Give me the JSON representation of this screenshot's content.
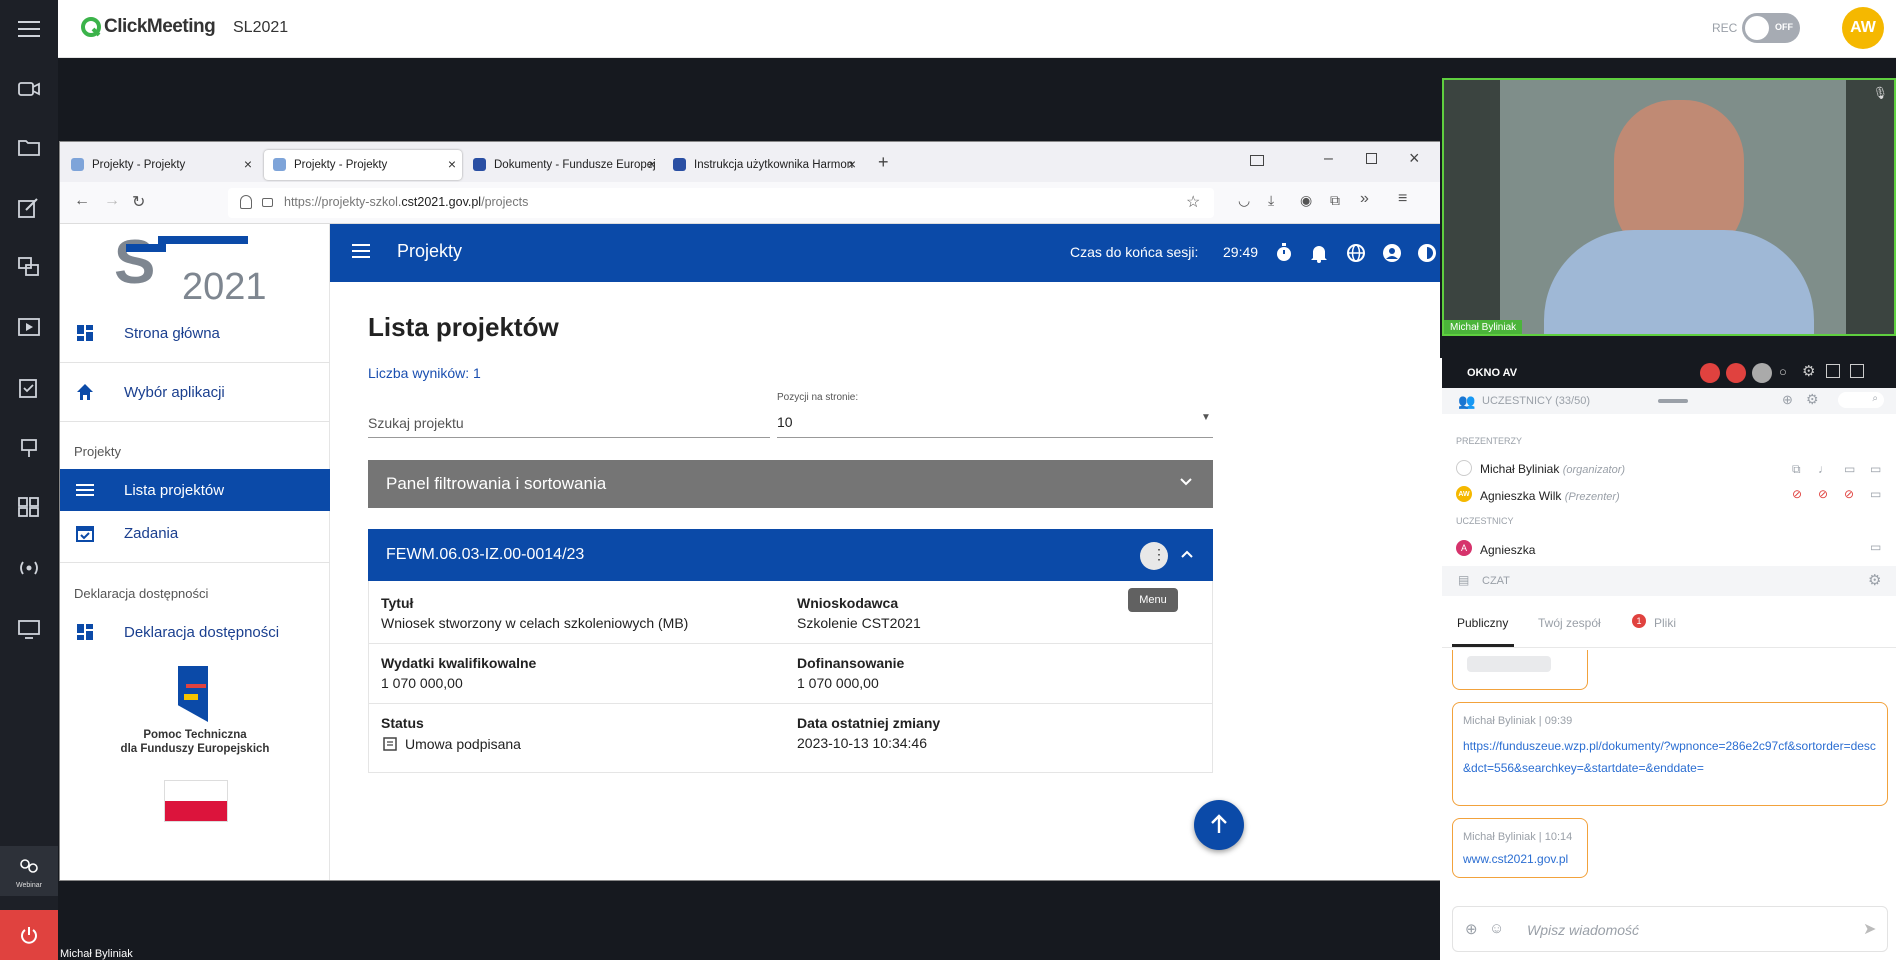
{
  "app": {
    "brand": "ClickMeeting",
    "room": "SL2021",
    "rec_label": "REC",
    "rec_state": "OFF",
    "avatar": "AW"
  },
  "rail": {
    "items": [
      "video-camera-icon",
      "folder-icon",
      "edit-icon",
      "screen-share-icon",
      "media-play-icon",
      "survey-icon",
      "whiteboard-icon",
      "apps-grid-icon",
      "broadcast-icon",
      "monitor-icon"
    ],
    "webinar_label": "Webinar",
    "accent": "#e0423f"
  },
  "presenter_bottom": "Michał Byliniak",
  "browser": {
    "tabs": [
      "Projekty - Projekty",
      "Projekty - Projekty",
      "Dokumenty - Fundusze Europej",
      "Instrukcja użytkownika Harmon"
    ],
    "url_prefix": "https://projekty-szkol.",
    "url_domain": "cst2021.gov.pl",
    "url_path": "/projects"
  },
  "app_header": {
    "title": "Projekty",
    "session_label": "Czas do końca sesji:",
    "session_time": "29:49",
    "color": "#0b4aa8"
  },
  "sidebar": {
    "logo_text": "2021",
    "home": "Strona główna",
    "app_select": "Wybór aplikacji",
    "section_projects": "Projekty",
    "projects_list": "Lista projektów",
    "tasks": "Zadania",
    "section_access": "Deklaracja dostępności",
    "access": "Deklaracja dostępności",
    "eu_line1": "Pomoc Techniczna",
    "eu_line2": "dla Funduszy Europejskich"
  },
  "main": {
    "heading": "Lista projektów",
    "results": "Liczba wyników: 1",
    "search_placeholder": "Szukaj projektu",
    "per_page_label": "Pozycji na stronie:",
    "per_page_value": "10",
    "filter_panel": "Panel filtrowania i sortowania",
    "project": {
      "code": "FEWM.06.03-IZ.00-0014/23",
      "menu_tooltip": "Menu",
      "title_label": "Tytuł",
      "title_value": "Wniosek stworzony w celach szkoleniowych (MB)",
      "applicant_label": "Wnioskodawca",
      "applicant_value": "Szkolenie CST2021",
      "costs_label": "Wydatki kwalifikowalne",
      "costs_value": "1 070 000,00",
      "funding_label": "Dofinansowanie",
      "funding_value": "1 070 000,00",
      "status_label": "Status",
      "status_value": "Umowa podpisana",
      "changed_label": "Data ostatniej zmiany",
      "changed_value": "2023-10-13 10:34:46"
    }
  },
  "video": {
    "name": "Michał Byliniak"
  },
  "av": {
    "title": "OKNO AV"
  },
  "participants": {
    "header": "UCZESTNICY (33/50)",
    "presenters_label": "PREZENTERZY",
    "p1_name": "Michał Byliniak",
    "p1_role": "(organizator)",
    "p2_name": "Agnieszka Wilk",
    "p2_role": "(Prezenter)",
    "p2_initials": "AW",
    "attendees_label": "UCZESTNICY",
    "a1_name": "Agnieszka",
    "a1_initial": "A"
  },
  "chat": {
    "header": "CZAT",
    "tab_public": "Publiczny",
    "tab_team": "Twój zespół",
    "tab_files": "Pliki",
    "files_badge": "1",
    "msg1_author": "Michał Byliniak",
    "msg1_time": "09:39",
    "msg1_text": "https://funduszeue.wzp.pl/dokumenty/?wpnonce=286e2c97cf&sortorder=desc&dct=556&searchkey=&startdate=&enddate=",
    "msg2_author": "Michał Byliniak",
    "msg2_time": "10:14",
    "msg2_text": "www.cst2021.gov.pl",
    "input_placeholder": "Wpisz wiadomość"
  }
}
